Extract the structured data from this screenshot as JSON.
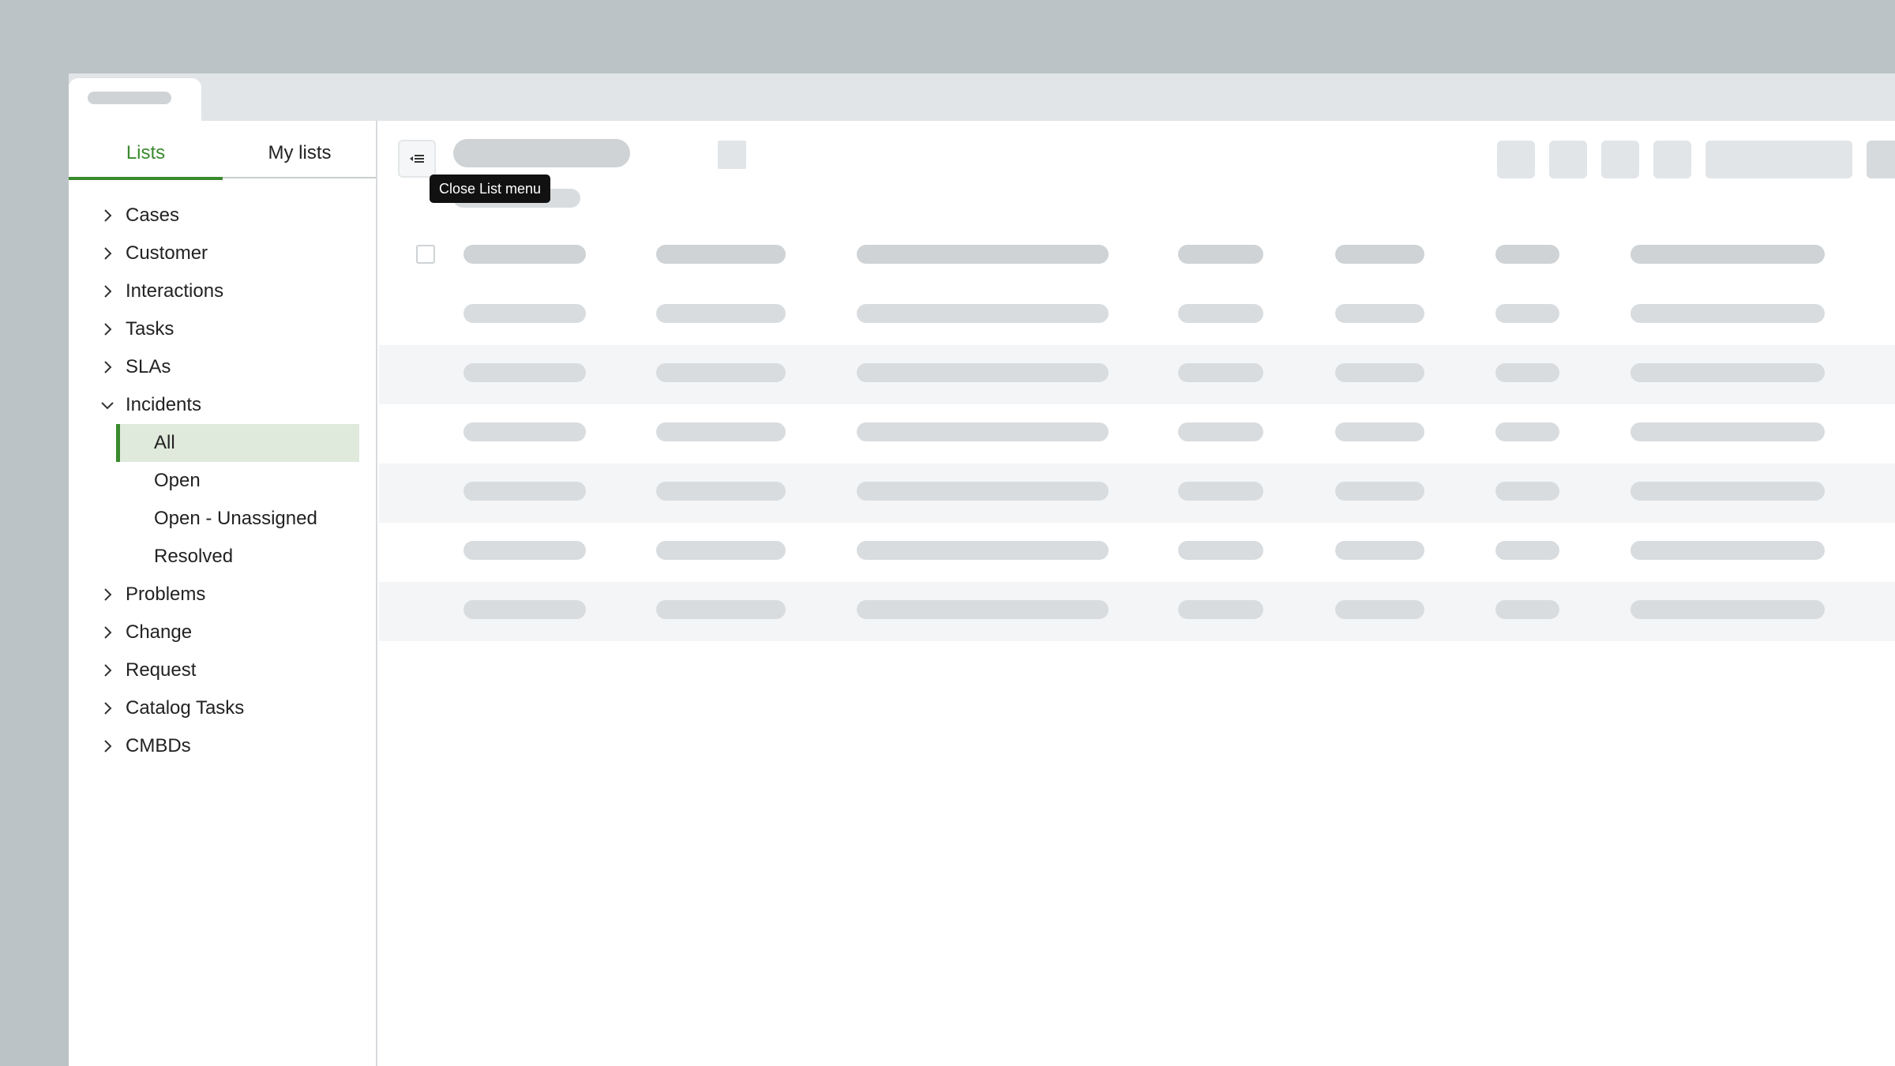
{
  "tooltip": {
    "text": "Close List menu"
  },
  "sidebar": {
    "tabs": [
      {
        "label": "Lists",
        "active": true
      },
      {
        "label": "My lists",
        "active": false
      }
    ],
    "items": [
      {
        "label": "Cases",
        "expanded": false
      },
      {
        "label": "Customer",
        "expanded": false
      },
      {
        "label": "Interactions",
        "expanded": false
      },
      {
        "label": "Tasks",
        "expanded": false
      },
      {
        "label": "SLAs",
        "expanded": false
      },
      {
        "label": "Incidents",
        "expanded": true,
        "children": [
          {
            "label": "All",
            "selected": true
          },
          {
            "label": "Open",
            "selected": false
          },
          {
            "label": "Open - Unassigned",
            "selected": false
          },
          {
            "label": "Resolved",
            "selected": false
          }
        ]
      },
      {
        "label": "Problems",
        "expanded": false
      },
      {
        "label": "Change",
        "expanded": false
      },
      {
        "label": "Request",
        "expanded": false
      },
      {
        "label": "Catalog Tasks",
        "expanded": false
      },
      {
        "label": "CMBDs",
        "expanded": false
      }
    ]
  },
  "main": {
    "collapse_button_icon": "collapse-list-menu-icon",
    "loading": true
  },
  "colors": {
    "accent": "#3a8a2e",
    "selected_bg": "#dfe9dc",
    "skeleton": "#d9dcdf",
    "tooltip_bg": "#111111"
  }
}
